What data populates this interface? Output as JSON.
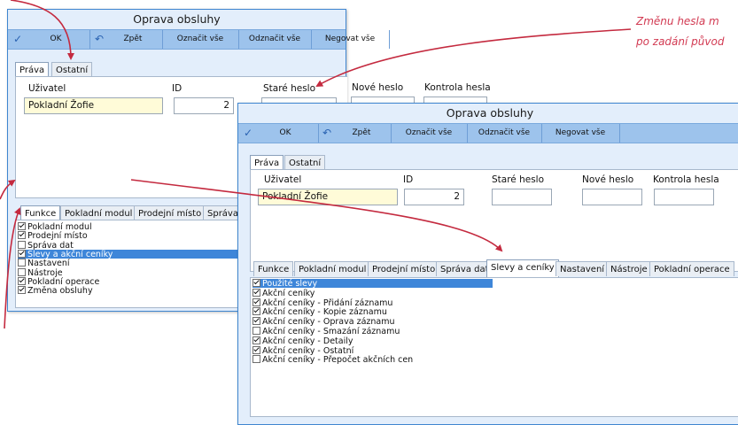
{
  "back_window": {
    "title": "Oprava obsluhy",
    "toolbar": {
      "ok": "OK",
      "back": "Zpět",
      "select_all": "Označit vše",
      "deselect_all": "Odznačit vše",
      "invert_all": "Negovat vše"
    },
    "top_tabs": [
      "Práva",
      "Ostatní"
    ],
    "fields": {
      "user_label": "Uživatel",
      "user_value": "Pokladní Žofie",
      "id_label": "ID",
      "id_value": "2",
      "old_pw_label": "Staré heslo",
      "new_pw_label": "Nové heslo",
      "check_pw_label": "Kontrola hesla"
    },
    "sub_tabs": [
      "Funkce",
      "Pokladní modul",
      "Prodejní místo",
      "Správa"
    ],
    "list": [
      {
        "label": "Pokladní modul",
        "checked": true
      },
      {
        "label": "Prodejní místo",
        "checked": true
      },
      {
        "label": "Správa dat",
        "checked": false
      },
      {
        "label": "Slevy a akční ceníky",
        "checked": true,
        "selected": true
      },
      {
        "label": "Nastavení",
        "checked": false
      },
      {
        "label": "Nástroje",
        "checked": false
      },
      {
        "label": "Pokladní operace",
        "checked": true
      },
      {
        "label": "Změna obsluhy",
        "checked": true
      }
    ]
  },
  "front_window": {
    "title": "Oprava obsluhy",
    "toolbar": {
      "ok": "OK",
      "back": "Zpět",
      "select_all": "Označit vše",
      "deselect_all": "Odznačit vše",
      "invert_all": "Negovat vše"
    },
    "top_tabs": [
      "Práva",
      "Ostatní"
    ],
    "fields": {
      "user_label": "Uživatel",
      "user_value": "Pokladní Žofie",
      "id_label": "ID",
      "id_value": "2",
      "old_pw_label": "Staré heslo",
      "new_pw_label": "Nové heslo",
      "check_pw_label": "Kontrola hesla"
    },
    "sub_tabs": [
      "Funkce",
      "Pokladní modul",
      "Prodejní místo",
      "Správa dat",
      "Slevy a ceníky",
      "Nastavení",
      "Nástroje",
      "Pokladní operace"
    ],
    "list": [
      {
        "label": "Použité slevy",
        "checked": true,
        "selected": true
      },
      {
        "label": "Akční ceníky",
        "checked": true
      },
      {
        "label": "Akční ceníky - Přidání záznamu",
        "checked": true
      },
      {
        "label": "Akční ceníky - Kopie záznamu",
        "checked": true
      },
      {
        "label": "Akční ceníky - Oprava záznamu",
        "checked": true
      },
      {
        "label": "Akční ceníky - Smazání záznamu",
        "checked": false
      },
      {
        "label": "Akční ceníky - Detaily",
        "checked": true
      },
      {
        "label": "Akční ceníky - Ostatní",
        "checked": true
      },
      {
        "label": "Akční ceníky - Přepočet akčních cen",
        "checked": false
      }
    ]
  },
  "annotation": {
    "line1": "Změnu hesla m",
    "line2": "po zadání původ"
  },
  "colors": {
    "accent": "#3e86d9",
    "annotation": "#d23a52",
    "toolbar": "#9dc3ec",
    "window": "#e3eefb"
  }
}
